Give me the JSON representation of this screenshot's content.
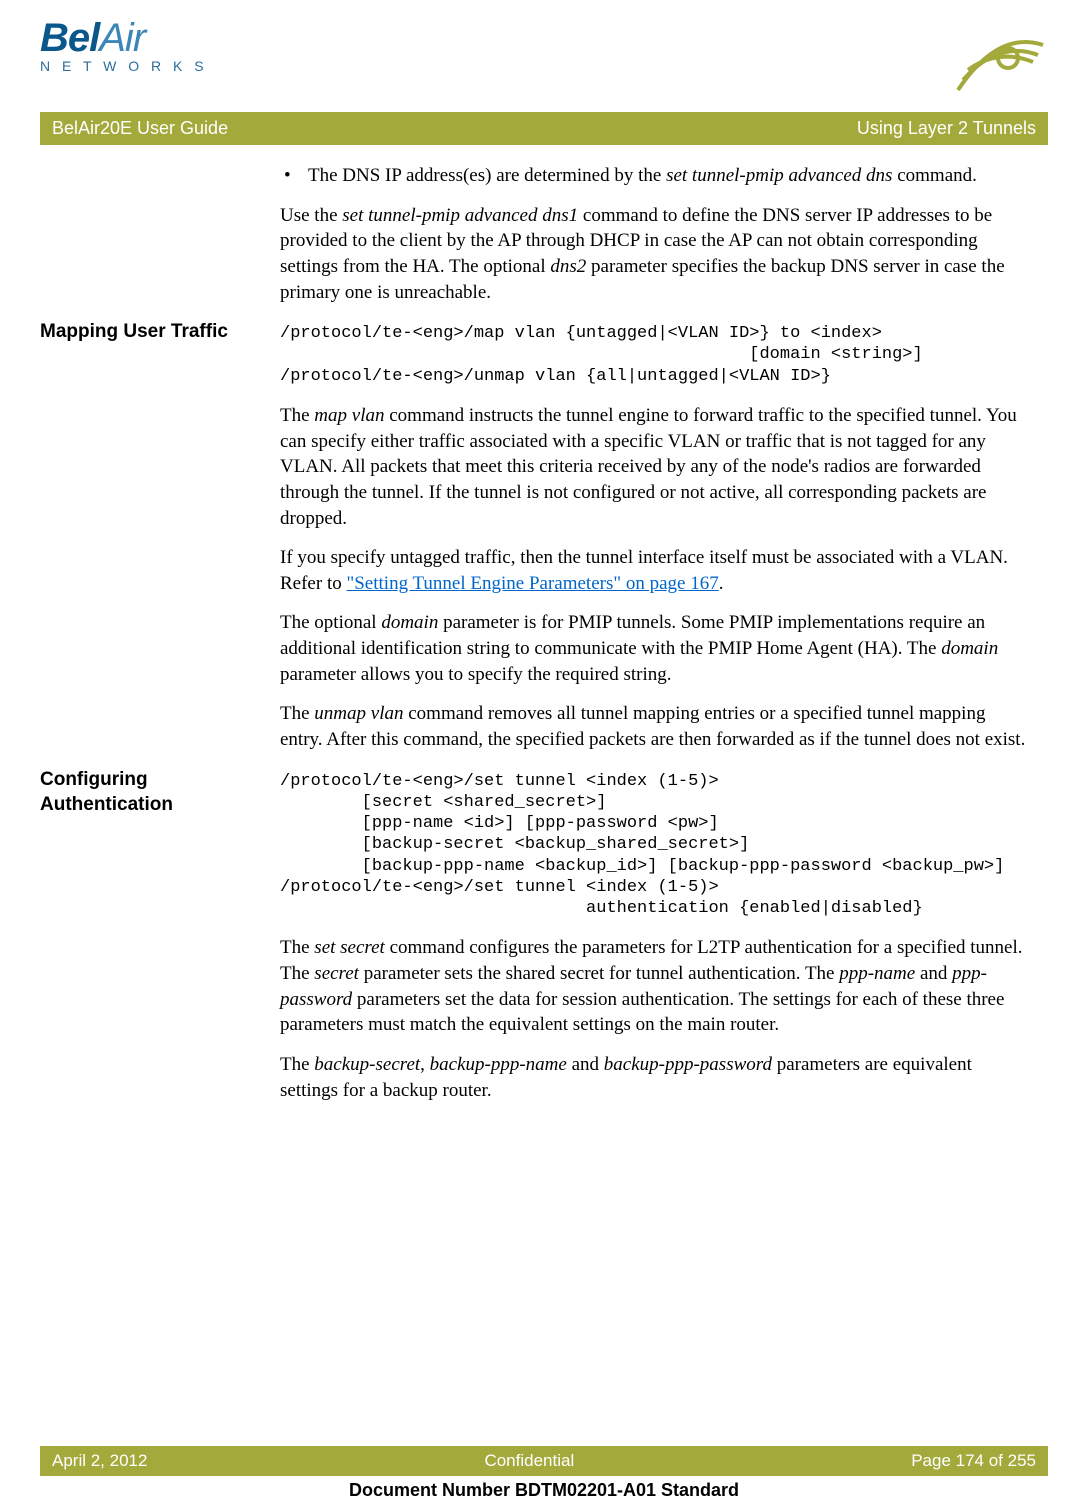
{
  "logo": {
    "brand1": "Bel",
    "brand2": "Air",
    "sub": "N E T W O R K S"
  },
  "titlebar": {
    "left": "BelAir20E User Guide",
    "right": "Using Layer 2 Tunnels"
  },
  "intro": {
    "bullet": "The DNS IP address(es) are determined by the ",
    "bullet_ital": "set tunnel-pmip advanced dns",
    "bullet_tail": " command.",
    "p1a": "Use the ",
    "p1_ital1": "set tunnel-pmip advanced dns1",
    "p1b": " command to define the DNS server IP addresses to be provided to the client by the AP through DHCP in case the AP can not obtain corresponding settings from the HA. The optional ",
    "p1_ital2": "dns2",
    "p1c": " parameter specifies the backup DNS server in case the primary one is unreachable."
  },
  "mapping": {
    "heading": "Mapping User Traffic",
    "code": "/protocol/te-<eng>/map vlan {untagged|<VLAN ID>} to <index>\n                                              [domain <string>]\n/protocol/te-<eng>/unmap vlan {all|untagged|<VLAN ID>}",
    "p1a": "The ",
    "p1_ital": "map vlan",
    "p1b": " command instructs the tunnel engine to forward traffic to the specified tunnel. You can specify either traffic associated with a specific VLAN or traffic that is not tagged for any VLAN. All packets that meet this criteria received by any of the node's radios are forwarded through the tunnel. If the tunnel is not configured or not active, all corresponding packets are dropped.",
    "p2a": "If you specify untagged traffic, then the tunnel interface itself must be associated with a VLAN. Refer to ",
    "p2_link": "\"Setting Tunnel Engine Parameters\" on page 167",
    "p2b": ".",
    "p3a": "The optional ",
    "p3_ital1": "domain",
    "p3b": " parameter is for PMIP tunnels. Some PMIP implementations require an additional identification string to communicate with the PMIP Home Agent (HA). The ",
    "p3_ital2": "domain",
    "p3c": " parameter allows you to specify the required string.",
    "p4a": "The ",
    "p4_ital": "unmap vlan",
    "p4b": " command removes all tunnel mapping entries or a specified tunnel mapping entry. After this command, the specified packets are then forwarded as if the tunnel does not exist."
  },
  "auth": {
    "heading": "Configuring Authentication",
    "code": "/protocol/te-<eng>/set tunnel <index (1-5)>\n        [secret <shared_secret>]\n        [ppp-name <id>] [ppp-password <pw>]\n        [backup-secret <backup_shared_secret>]\n        [backup-ppp-name <backup_id>] [backup-ppp-password <backup_pw>]\n/protocol/te-<eng>/set tunnel <index (1-5)>\n                              authentication {enabled|disabled}",
    "p1a": "The ",
    "p1_ital1": "set secret",
    "p1b": " command configures the parameters for L2TP authentication for a specified tunnel. The ",
    "p1_ital2": "secret",
    "p1c": " parameter sets the shared secret for tunnel authentication. The ",
    "p1_ital3": "ppp-name",
    "p1d": " and ",
    "p1_ital4": "ppp-password",
    "p1e": " parameters set the data for session authentication. The settings for each of these three parameters must match the equivalent settings on the main router.",
    "p2a": "The ",
    "p2_ital1": "backup-secret",
    "p2b": ", ",
    "p2_ital2": "backup-ppp-name",
    "p2c": " and ",
    "p2_ital3": "backup-ppp-password",
    "p2d": " parameters are equivalent settings for a backup router."
  },
  "footer": {
    "left": "April 2, 2012",
    "center": "Confidential",
    "right": "Page 174 of 255",
    "docnum": "Document Number BDTM02201-A01 Standard"
  }
}
